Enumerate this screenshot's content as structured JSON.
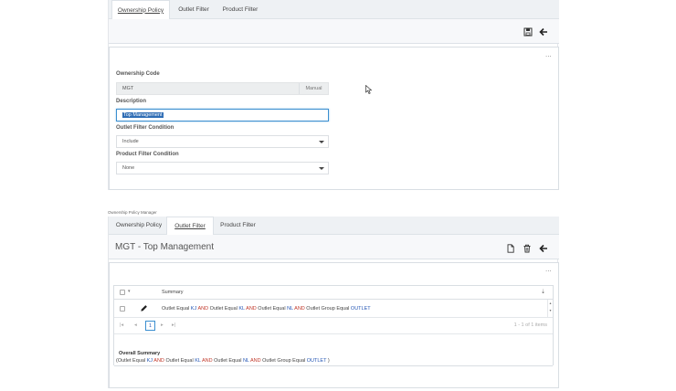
{
  "top_panel": {
    "tabs": [
      {
        "label": "Ownership Policy",
        "active": true
      },
      {
        "label": "Outlet Filter",
        "active": false
      },
      {
        "label": "Product Filter",
        "active": false
      }
    ],
    "menu_dots": "...",
    "form": {
      "ownership_code_label": "Ownership Code",
      "ownership_code_value": "MGT",
      "ownership_code_suffix": "Manual",
      "description_label": "Description",
      "description_value": "Top Management",
      "outlet_filter_label": "Outlet Filter Condition",
      "outlet_filter_value": "Include",
      "product_filter_label": "Product Filter Condition",
      "product_filter_value": "None"
    }
  },
  "bottom_panel": {
    "breadcrumb": "Ownership Policy Manager",
    "tabs": [
      {
        "label": "Ownership Policy",
        "active": false
      },
      {
        "label": "Outlet Filter",
        "active": true
      },
      {
        "label": "Product Filter",
        "active": false
      }
    ],
    "title": "MGT - Top Management",
    "menu_dots": "...",
    "grid": {
      "header_summary": "Summary",
      "row": {
        "parts": [
          {
            "t": "Outlet Equal ",
            "k": "plain"
          },
          {
            "t": "KJ",
            "k": "val"
          },
          {
            "t": " AND ",
            "k": "and"
          },
          {
            "t": "Outlet Equal ",
            "k": "plain"
          },
          {
            "t": "KL",
            "k": "val"
          },
          {
            "t": " AND ",
            "k": "and"
          },
          {
            "t": "Outlet Equal ",
            "k": "plain"
          },
          {
            "t": "NL",
            "k": "val"
          },
          {
            "t": " AND ",
            "k": "and"
          },
          {
            "t": "Outlet Group Equal ",
            "k": "plain"
          },
          {
            "t": "OUTLET",
            "k": "val"
          }
        ]
      },
      "pager": {
        "first": "|◂",
        "prev": "◂",
        "current": "1",
        "next": "▸",
        "last": "▸|",
        "info": "1 - 1 of 1 items"
      }
    },
    "overall_summary_label": "Overall Summary",
    "overall_summary_parts": [
      {
        "t": "(Outlet Equal ",
        "k": "plain"
      },
      {
        "t": "KJ",
        "k": "val"
      },
      {
        "t": " AND ",
        "k": "and"
      },
      {
        "t": "Outlet Equal ",
        "k": "plain"
      },
      {
        "t": "KL",
        "k": "val"
      },
      {
        "t": " AND ",
        "k": "and"
      },
      {
        "t": "Outlet Equal ",
        "k": "plain"
      },
      {
        "t": "NL",
        "k": "val"
      },
      {
        "t": " AND ",
        "k": "and"
      },
      {
        "t": "Outlet Group Equal ",
        "k": "plain"
      },
      {
        "t": "OUTLET",
        "k": "val"
      },
      {
        "t": " )",
        "k": "plain"
      }
    ]
  },
  "colors": {
    "accent": "#3b8fd0",
    "and_keyword": "#c0392b",
    "value_keyword": "#2456b4",
    "tabbar": "#eef1f4"
  }
}
